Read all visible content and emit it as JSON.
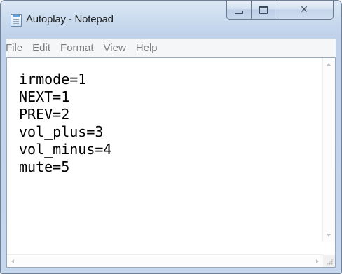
{
  "window": {
    "title": "Autoplay - Notepad",
    "icon": "notepad-icon",
    "controls": {
      "minimize_icon": "minimize-icon",
      "maximize_icon": "maximize-icon",
      "close_glyph": "✕"
    }
  },
  "menu": {
    "items": [
      {
        "label": "File"
      },
      {
        "label": "Edit"
      },
      {
        "label": "Format"
      },
      {
        "label": "View"
      },
      {
        "label": "Help"
      }
    ]
  },
  "editor": {
    "lines": [
      "irmode=1",
      "NEXT=1",
      "PREV=2",
      "vol_plus=3",
      "vol_minus=4",
      "mute=5"
    ]
  },
  "colors": {
    "frame": "#c9daee",
    "menu_text": "#7b7b7b",
    "editor_background": "#ffffff",
    "text": "#000000"
  }
}
